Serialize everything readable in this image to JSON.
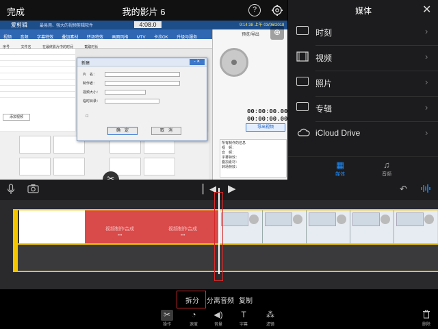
{
  "topbar": {
    "done": "完成",
    "title": "我的影片 6",
    "help_icon": "?",
    "settings_icon": "⚙"
  },
  "preview": {
    "app_name": "爱剪辑",
    "app_tagline": "最易用、强大的视频剪辑软件",
    "time_overlay": "4:08.0",
    "clock": "9:14:38 上午 03/06/2018",
    "menu": [
      "视频",
      "音频",
      "字幕特效",
      "叠加素材",
      "转场特效",
      "画面风格",
      "MTV",
      "卡拉OK",
      "升级与服务"
    ],
    "toolbar": [
      "序号",
      "文件名",
      "在最终影片中的时间",
      "截取时长"
    ],
    "right_title": "预览/导出",
    "timecode_1": "00:00:00.000",
    "timecode_2": "00:00:00.000",
    "export_btn": "导出视频",
    "add_video": "添加视频",
    "info_title": "所有制作的信息",
    "info_lines": [
      "视　频：",
      "音　频：",
      "字幕特效：",
      "叠加素材：",
      "转场特效："
    ],
    "dialog": {
      "title": "新建",
      "field_1": "片　名：",
      "field_2": "制作者：",
      "field_3": "视频大小：",
      "field_4": "临时目录：",
      "ok": "确　定",
      "cancel": "取　消"
    }
  },
  "media_panel": {
    "title": "媒体",
    "close": "✕",
    "items": [
      {
        "label": "时刻",
        "icon": "moments-icon"
      },
      {
        "label": "视频",
        "icon": "video-icon"
      },
      {
        "label": "照片",
        "icon": "photo-icon"
      },
      {
        "label": "专辑",
        "icon": "album-icon"
      },
      {
        "label": "iCloud Drive",
        "icon": "icloud-icon"
      }
    ],
    "tabs": [
      {
        "label": "媒体",
        "active": true
      },
      {
        "label": "音频",
        "active": false
      }
    ]
  },
  "timeline": {
    "red_labels": [
      "视频制作合成",
      "视频制作合成"
    ]
  },
  "actions": {
    "split": "拆分",
    "detach_audio": "分离音频",
    "duplicate": "复制"
  },
  "tools": [
    {
      "label": "操作",
      "icon": "scissors-icon"
    },
    {
      "label": "速度",
      "icon": "speed-icon"
    },
    {
      "label": "音量",
      "icon": "volume-icon"
    },
    {
      "label": "字幕",
      "icon": "titles-icon"
    },
    {
      "label": "滤镜",
      "icon": "filters-icon"
    }
  ],
  "delete_label": "删除",
  "colors": {
    "accent": "#1a8cff",
    "clip_border": "#f2c500",
    "highlight": "#d62a2a"
  }
}
